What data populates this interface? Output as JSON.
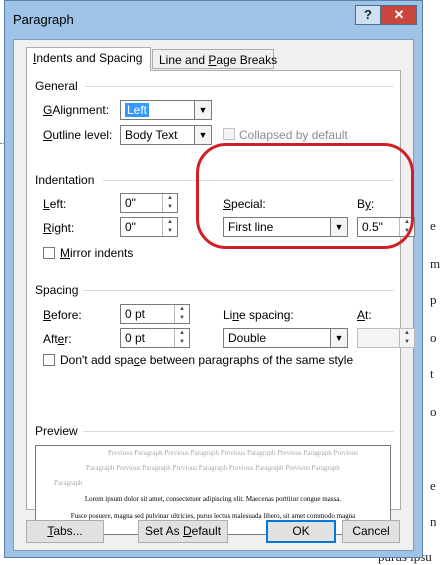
{
  "window": {
    "title": "Paragraph",
    "help_label": "?",
    "close_label": "✕"
  },
  "tabs": [
    {
      "label": "Indents and Spacing",
      "underline": "I",
      "rest": "ndents and Spacing",
      "active": true
    },
    {
      "label": "Line and Page Breaks",
      "pre": "Line and ",
      "underline": "P",
      "rest": "age Breaks",
      "active": false
    }
  ],
  "general": {
    "heading": "General",
    "alignment_label_u": "G",
    "alignment_label_rest": "Alignment:",
    "alignment_value": "Left",
    "outline_label_u": "O",
    "outline_label_rest": "utline level:",
    "outline_value": "Body Text",
    "collapsed_label": "Collapsed by default"
  },
  "indentation": {
    "heading": "Indentation",
    "left_label_u": "L",
    "left_label_rest": "eft:",
    "left_value": "0\"",
    "right_label_u": "R",
    "right_label_rest": "ight:",
    "right_value": "0\"",
    "mirror_label_u": "M",
    "mirror_label_rest": "irror indents",
    "special_label_u": "S",
    "special_label_rest": "pecial:",
    "special_value": "First line",
    "by_label_pre": "B",
    "by_label_u": "y",
    "by_label_rest": ":",
    "by_value": "0.5\""
  },
  "spacing": {
    "heading": "Spacing",
    "before_label_u": "B",
    "before_label_rest": "efore:",
    "before_value": "0 pt",
    "after_label_pre": "Aft",
    "after_label_u": "e",
    "after_label_rest": "r:",
    "after_value": "0 pt",
    "line_spacing_label_pre": "Li",
    "line_spacing_label_u": "n",
    "line_spacing_label_rest": "e spacing:",
    "line_spacing_value": "Double",
    "at_label_u": "A",
    "at_label_rest": "t:",
    "at_value": "",
    "dont_add_pre": "Don't add spa",
    "dont_add_u": "c",
    "dont_add_rest": "e between paragraphs of the same style"
  },
  "preview": {
    "heading": "Preview",
    "prev_line_1": "Previous Paragraph Previous Paragraph Previous Paragraph Previous Paragraph Previous",
    "prev_line_2": "Paragraph Previous Paragraph Previous Paragraph Previous Paragraph Previous Paragraph",
    "prev_line_3": "Paragraph",
    "cur_line_1": "Lorem ipsum dolor sit amet, consectetuer adipiscing elit. Maecenas porttitor congue massa.",
    "cur_line_2": "Fusce posuere, magna sed pulvinar ultricies, purus lectus malesuada libero, sit amet commodo magna"
  },
  "buttons": {
    "tabs_u": "T",
    "tabs_rest": "abs...",
    "default_pre": "Set As ",
    "default_u": "D",
    "default_rest": "efault",
    "ok": "OK",
    "cancel": "Cancel"
  },
  "background": {
    "fragments": [
      "e",
      "m",
      "p",
      "o",
      "t",
      "o",
      "e",
      "n"
    ],
    "bottom": "purus ipsu"
  },
  "colors": {
    "annotation": "#d21f26",
    "selection": "#3399ff",
    "frame": "#9fc3e6",
    "close": "#c9463d"
  }
}
